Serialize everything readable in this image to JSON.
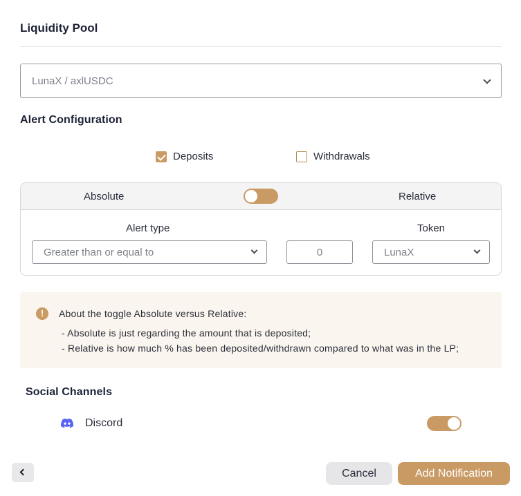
{
  "liquidity_pool": {
    "title": "Liquidity Pool",
    "selected_pool": "LunaX / axlUSDC"
  },
  "alert_configuration": {
    "title": "Alert Configuration",
    "deposits": {
      "label": "Deposits",
      "checked": true
    },
    "withdrawals": {
      "label": "Withdrawals",
      "checked": false
    },
    "mode": {
      "absolute_label": "Absolute",
      "relative_label": "Relative",
      "relative_selected": false
    },
    "alert_type": {
      "label": "Alert type",
      "value": "Greater than or equal to"
    },
    "amount": {
      "value": "0"
    },
    "token": {
      "label": "Token",
      "value": "LunaX"
    }
  },
  "info": {
    "icon": "exclamation-icon",
    "heading": "About the toggle Absolute versus Relative:",
    "line1": "- Absolute is just regarding the amount that is deposited;",
    "line2": "- Relative is how much % has been deposited/withdrawn compared to what was in the LP;"
  },
  "social_channels": {
    "title": "Social Channels",
    "discord": {
      "label": "Discord",
      "icon": "discord-icon",
      "enabled": true
    }
  },
  "footer": {
    "cancel_label": "Cancel",
    "add_label": "Add Notification"
  },
  "colors": {
    "accent": "#c99a64",
    "info_bg": "#faf5ee",
    "discord": "#5865f2"
  }
}
